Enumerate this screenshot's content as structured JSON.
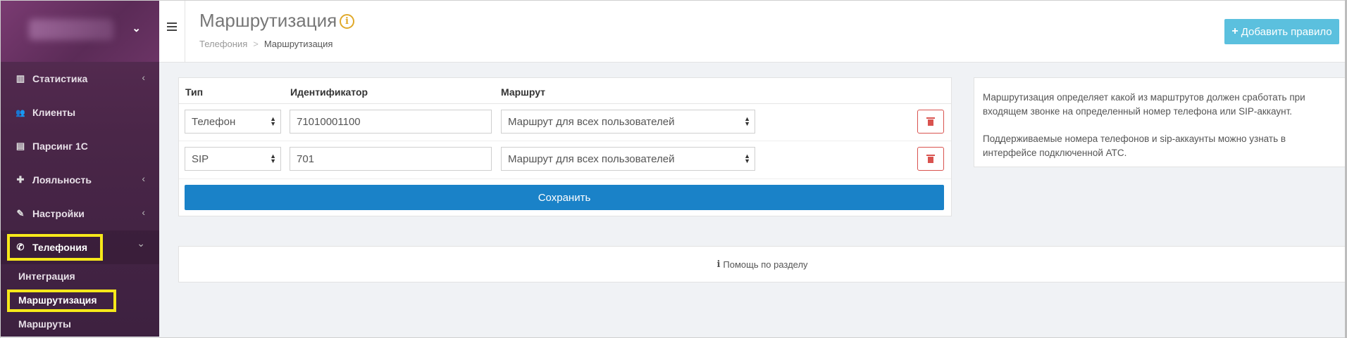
{
  "sidebar": {
    "items": [
      {
        "icon": "bar-chart-icon",
        "glyph": "▥",
        "label": "Статистика",
        "arrow": "‹"
      },
      {
        "icon": "users-icon",
        "glyph": "👥",
        "label": "Клиенты",
        "arrow": ""
      },
      {
        "icon": "file-icon",
        "glyph": "▤",
        "label": "Парсинг 1С",
        "arrow": ""
      },
      {
        "icon": "gift-icon",
        "glyph": "✚",
        "label": "Лояльность",
        "arrow": "‹"
      },
      {
        "icon": "wrench-icon",
        "glyph": "✎",
        "label": "Настройки",
        "arrow": "‹"
      },
      {
        "icon": "phone-icon",
        "glyph": "✆",
        "label": "Телефония",
        "arrow": "⌄"
      }
    ],
    "subitems": [
      "Интеграция",
      "Маршрутизация",
      "Маршруты"
    ]
  },
  "header": {
    "title": "Маршрутизация",
    "info_glyph": "i",
    "breadcrumb": {
      "root": "Телефония",
      "separator": ">",
      "current": "Маршрутизация"
    },
    "add_button": "Добавить правило",
    "add_plus": "+"
  },
  "table": {
    "columns": [
      "Тип",
      "Идентификатор",
      "Маршрут"
    ],
    "rows": [
      {
        "type": "Телефон",
        "identifier": "71010001100",
        "route": "Маршрут для всех пользователей"
      },
      {
        "type": "SIP",
        "identifier": "701",
        "route": "Маршрут для всех пользователей"
      }
    ],
    "save_button": "Сохранить"
  },
  "info": {
    "paragraph1": "Маршрутизация определяет какой из марштрутов должен сработать при входящем звонке на определенный номер телефона или SIP-аккаунт.",
    "paragraph2": "Поддерживаемые номера телефонов и sip-аккаунты можно узнать в интерфейсе подключенной АТС."
  },
  "help": {
    "icon": "i",
    "label": "Помощь по разделу"
  },
  "colors": {
    "sidebar": "#4a2648",
    "highlight": "#f6e81a",
    "primary": "#1a82c8",
    "add": "#5bc0de",
    "danger": "#d9534f"
  }
}
